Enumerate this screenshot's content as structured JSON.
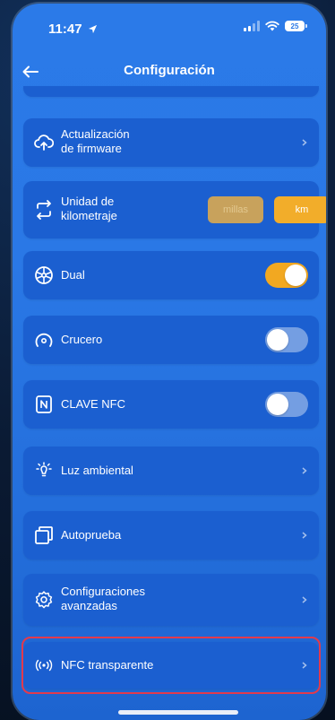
{
  "status_bar": {
    "time": "11:47",
    "battery": "25"
  },
  "header": {
    "title": "Configuración",
    "back_icon": "arrow-left-icon"
  },
  "items": {
    "firmware": {
      "line1": "Actualización",
      "line2": "de firmware",
      "icon": "cloud-upload-icon"
    },
    "unit": {
      "line1": "Unidad de",
      "line2": "kilometraje",
      "icon": "swap-arrows-icon",
      "option_miles": "millas",
      "option_km": "km",
      "selected": "km"
    },
    "dual": {
      "label": "Dual",
      "icon": "wheel-icon",
      "enabled": true
    },
    "cruise": {
      "label": "Crucero",
      "icon": "speedometer-icon",
      "enabled": false
    },
    "nfc_key": {
      "label": "CLAVE NFC",
      "icon": "nfc-icon",
      "enabled": false
    },
    "ambient": {
      "label": "Luz ambiental",
      "icon": "light-icon"
    },
    "selftest": {
      "label": "Autoprueba",
      "icon": "self-test-icon"
    },
    "advanced": {
      "line1": "Configuraciones",
      "line2": "avanzadas",
      "icon": "settings-gear-icon"
    },
    "nfc_transparent": {
      "label": "NFC transparente",
      "icon": "nfc-waves-icon"
    }
  },
  "colors": {
    "background": "#2a78e6",
    "card": "#1b5fd0",
    "accent": "#f2ad2a",
    "highlight": "#e23a4d"
  }
}
